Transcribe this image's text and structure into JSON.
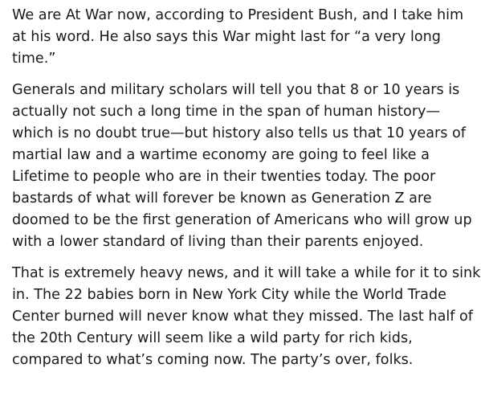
{
  "paragraphs": [
    {
      "lines": [
        "We are At War now, according to President Bush, and I take him",
        "at his word. He also says this War might last for “a very long",
        "time.”"
      ]
    },
    {
      "lines": [
        "Generals and military scholars will tell you that 8 or 10 years is",
        "actually not such a long time in the span of human history—",
        "which is no doubt true—but history also tells us that 10 years of",
        "martial law and a wartime economy are going to feel like a",
        "Lifetime to people who are in their twenties today. The poor",
        "bastards of what will forever be known as Generation Z are",
        "doomed to be the first generation of Americans who will grow up",
        "with a lower standard of living than their parents enjoyed."
      ]
    },
    {
      "lines": [
        "That is extremely heavy news, and it will take a while for it to sink",
        "in. The 22 babies born in New York City while the World Trade",
        "Center burned will never know what they missed. The last half of",
        "the 20th Century will seem like a wild party for rich kids,",
        "compared to what’s coming now. The party’s over, folks."
      ]
    }
  ]
}
